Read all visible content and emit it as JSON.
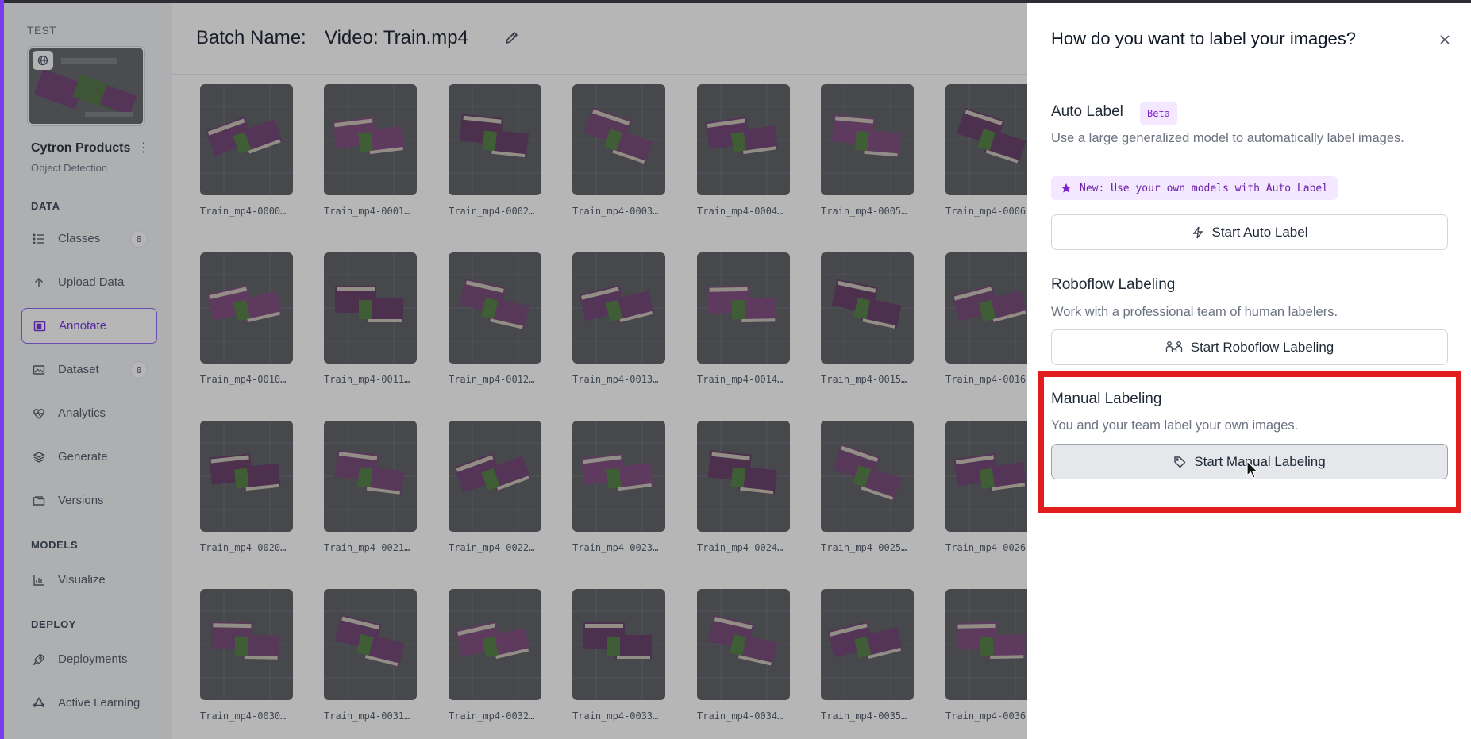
{
  "sidebar": {
    "workspace": "TEST",
    "project_name": "Cytron Products",
    "project_type": "Object Detection",
    "sections": {
      "data": "DATA",
      "models": "MODELS",
      "deploy": "DEPLOY"
    },
    "items": [
      {
        "label": "Classes",
        "icon": "list-icon",
        "badge": "0"
      },
      {
        "label": "Upload Data",
        "icon": "upload-icon"
      },
      {
        "label": "Annotate",
        "icon": "annotate-icon",
        "active": true
      },
      {
        "label": "Dataset",
        "icon": "images-icon",
        "badge": "0"
      },
      {
        "label": "Analytics",
        "icon": "heart-pulse-icon"
      },
      {
        "label": "Generate",
        "icon": "layers-icon"
      },
      {
        "label": "Versions",
        "icon": "folder-icon"
      },
      {
        "label": "Visualize",
        "icon": "chart-icon"
      },
      {
        "label": "Deployments",
        "icon": "rocket-icon"
      },
      {
        "label": "Active Learning",
        "icon": "recycle-icon"
      }
    ]
  },
  "main": {
    "batch_label": "Batch Name:",
    "batch_value": "Video: Train.mp4",
    "images": [
      [
        "Train_mp4-0000…",
        "Train_mp4-0001…",
        "Train_mp4-0002…",
        "Train_mp4-0003…",
        "Train_mp4-0004…",
        "Train_mp4-0005…",
        "Train_mp4-0006"
      ],
      [
        "Train_mp4-0010…",
        "Train_mp4-0011…",
        "Train_mp4-0012…",
        "Train_mp4-0013…",
        "Train_mp4-0014…",
        "Train_mp4-0015…",
        "Train_mp4-0016"
      ],
      [
        "Train_mp4-0020…",
        "Train_mp4-0021…",
        "Train_mp4-0022…",
        "Train_mp4-0023…",
        "Train_mp4-0024…",
        "Train_mp4-0025…",
        "Train_mp4-0026"
      ],
      [
        "Train_mp4-0030…",
        "Train_mp4-0031…",
        "Train_mp4-0032…",
        "Train_mp4-0033…",
        "Train_mp4-0034…",
        "Train_mp4-0035…",
        "Train_mp4-0036"
      ]
    ]
  },
  "panel": {
    "title": "How do you want to label your images?",
    "auto_label": {
      "title": "Auto Label",
      "badge": "Beta",
      "description": "Use a large generalized model to automatically label images.",
      "new_note": "New: Use your own models with Auto Label",
      "button": "Start Auto Label"
    },
    "roboflow_labeling": {
      "title": "Roboflow Labeling",
      "description": "Work with a professional team of human labelers.",
      "button": "Start Roboflow Labeling"
    },
    "manual_labeling": {
      "title": "Manual Labeling",
      "description": "You and your team label your own images.",
      "button": "Start Manual Labeling"
    }
  },
  "colors": {
    "accent": "#7c3aed",
    "highlight": "#e11d1d",
    "badge_bg": "#f3e8ff"
  }
}
